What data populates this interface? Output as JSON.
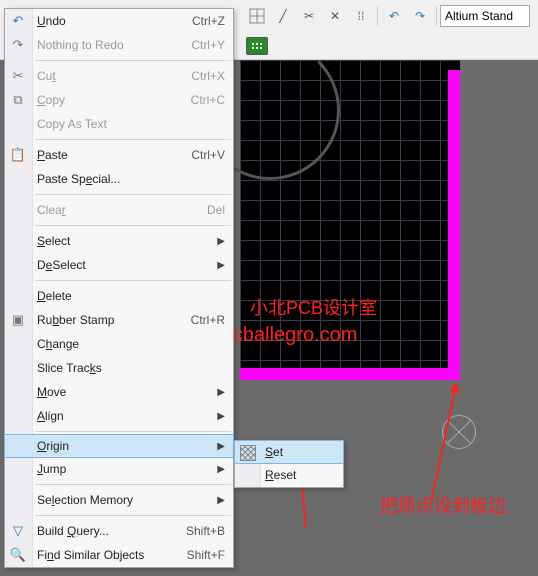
{
  "toolbar": {
    "altium_label": "Altium Stand"
  },
  "menu": {
    "undo": {
      "label_pre": "",
      "label_ul": "U",
      "label_post": "ndo",
      "shortcut": "Ctrl+Z"
    },
    "redo": {
      "label_pre": "Nothing to Redo",
      "label_ul": "",
      "label_post": "",
      "shortcut": "Ctrl+Y"
    },
    "cut": {
      "label_pre": "Cu",
      "label_ul": "t",
      "label_post": "",
      "shortcut": "Ctrl+X"
    },
    "copy": {
      "label_pre": "",
      "label_ul": "C",
      "label_post": "opy",
      "shortcut": "Ctrl+C"
    },
    "copy_as_text": {
      "label_pre": "Copy As Text",
      "label_ul": "",
      "label_post": "",
      "shortcut": ""
    },
    "paste": {
      "label_pre": "",
      "label_ul": "P",
      "label_post": "aste",
      "shortcut": "Ctrl+V"
    },
    "paste_special": {
      "label_pre": "Paste Sp",
      "label_ul": "e",
      "label_post": "cial...",
      "shortcut": ""
    },
    "clear": {
      "label_pre": "Clea",
      "label_ul": "r",
      "label_post": "",
      "shortcut": "Del"
    },
    "select": {
      "label_pre": "",
      "label_ul": "S",
      "label_post": "elect",
      "shortcut": ""
    },
    "deselect": {
      "label_pre": "D",
      "label_ul": "e",
      "label_post": "Select",
      "shortcut": ""
    },
    "delete": {
      "label_pre": "",
      "label_ul": "D",
      "label_post": "elete",
      "shortcut": ""
    },
    "rubber_stamp": {
      "label_pre": "Ru",
      "label_ul": "b",
      "label_post": "ber Stamp",
      "shortcut": "Ctrl+R"
    },
    "change": {
      "label_pre": "C",
      "label_ul": "h",
      "label_post": "ange",
      "shortcut": ""
    },
    "slice_tracks": {
      "label_pre": "Slice Trac",
      "label_ul": "k",
      "label_post": "s",
      "shortcut": ""
    },
    "move": {
      "label_pre": "",
      "label_ul": "M",
      "label_post": "ove",
      "shortcut": ""
    },
    "align": {
      "label_pre": "",
      "label_ul": "A",
      "label_post": "lign",
      "shortcut": ""
    },
    "origin": {
      "label_pre": "",
      "label_ul": "O",
      "label_post": "rigin",
      "shortcut": ""
    },
    "jump": {
      "label_pre": "",
      "label_ul": "J",
      "label_post": "ump",
      "shortcut": ""
    },
    "selection_memory": {
      "label_pre": "Se",
      "label_ul": "l",
      "label_post": "ection Memory",
      "shortcut": ""
    },
    "build_query": {
      "label_pre": "Build ",
      "label_ul": "Q",
      "label_post": "uery...",
      "shortcut": "Shift+B"
    },
    "find_similar": {
      "label_pre": "Fi",
      "label_ul": "n",
      "label_post": "d Similar Objects",
      "shortcut": "Shift+F"
    }
  },
  "submenu": {
    "set": {
      "label_pre": "",
      "label_ul": "S",
      "label_post": "et"
    },
    "reset": {
      "label_pre": "",
      "label_ul": "R",
      "label_post": "eset"
    }
  },
  "watermark": {
    "line1": "小北PCB设计室",
    "line2": "www.pcballegro.com"
  },
  "annotation": {
    "text": "把原点设到板边"
  }
}
